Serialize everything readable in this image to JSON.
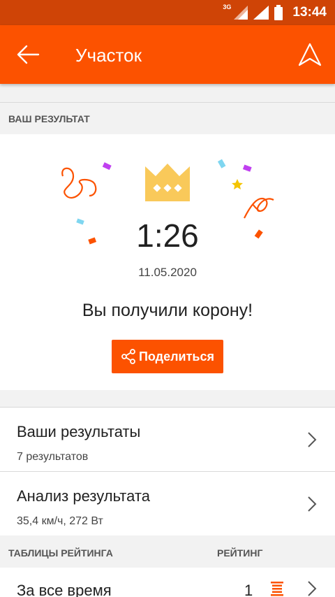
{
  "status_bar": {
    "network": "3G",
    "time": "13:44"
  },
  "app_bar": {
    "title": "Участок",
    "back_icon": "arrow-left-icon",
    "nav_icon": "navigation-arrow-icon"
  },
  "result_section": {
    "header": "ВАШ РЕЗУЛЬТАТ",
    "time": "1:26",
    "date": "11.05.2020",
    "message": "Вы получили корону!",
    "share_label": "Поделиться",
    "share_icon": "share-icon",
    "crown_icon": "crown-icon"
  },
  "list": [
    {
      "title": "Ваши результаты",
      "subtitle": "7 результатов"
    },
    {
      "title": "Анализ результата",
      "subtitle": "35,4 км/ч, 272 Вт"
    }
  ],
  "leaderboards": {
    "header": "ТАБЛИЦЫ РЕЙТИНГА",
    "rank_header": "РЕЙТИНГ",
    "rows": [
      {
        "title": "За все время",
        "rank": "1"
      }
    ]
  },
  "colors": {
    "accent": "#fc5200",
    "status_bar": "#cf4406",
    "crown": "#f9c95a"
  }
}
